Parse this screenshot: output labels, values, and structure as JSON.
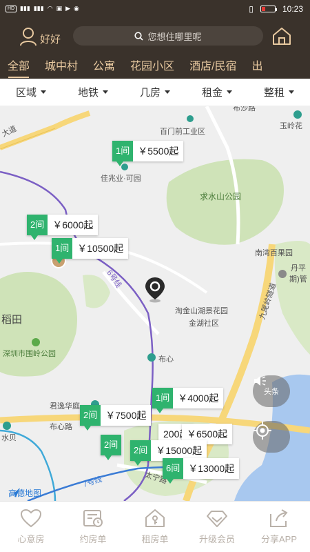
{
  "status_bar": {
    "time": "10:23"
  },
  "header": {
    "user_name": "好好",
    "search_placeholder": "您想住哪里呢"
  },
  "tabs": [
    "全部",
    "城中村",
    "公寓",
    "花园小区",
    "酒店/民宿",
    "出"
  ],
  "filters": [
    "区域",
    "地铁",
    "几房",
    "租金",
    "整租"
  ],
  "map_labels": {
    "bu_sha_lu": "布沙路",
    "baimen": "百门前工业区",
    "yuling": "玉岭花",
    "jiazhao": "佳兆业·可园",
    "qiushui": "求水山公园",
    "nanwan": "南湾百果园",
    "danping": "丹平",
    "qiguan": "期)管",
    "taojin": "淘金山湖景花园",
    "jinhu": "金湖社区",
    "jiuwei": "九尾岭隧道",
    "daotian": "稻田",
    "weiling": "深圳市围岭公园",
    "buxin": "布心",
    "junyi": "君逸华庭",
    "buxin_road": "布心路",
    "shuibei": "水贝",
    "taining": "太宁路",
    "line6": "6号线",
    "line7": "7号线",
    "dao": "大道"
  },
  "pins": [
    {
      "rooms": "1间",
      "price": "￥5500起"
    },
    {
      "rooms": "2间",
      "price": "￥6000起"
    },
    {
      "rooms": "1间",
      "price": "￥10500起"
    },
    {
      "rooms": "1间",
      "price": "￥4000起"
    },
    {
      "rooms": "2间",
      "price": "￥7500起"
    },
    {
      "rooms": "",
      "price": "200起"
    },
    {
      "rooms": "",
      "price": "￥6500起"
    },
    {
      "rooms": "2间",
      "price": ""
    },
    {
      "rooms": "2间",
      "price": "￥15000起"
    },
    {
      "rooms": "6间",
      "price": "￥13000起"
    }
  ],
  "map_controls": {
    "news_label": "头条"
  },
  "amap_logo": "高德地图",
  "bottom_nav": [
    "心意房",
    "约房单",
    "租房单",
    "升级会员",
    "分享APP"
  ],
  "colors": {
    "header_bg": "#3a322b",
    "accent_gold": "#e8c9a0",
    "pin_green": "#2fb36e"
  }
}
